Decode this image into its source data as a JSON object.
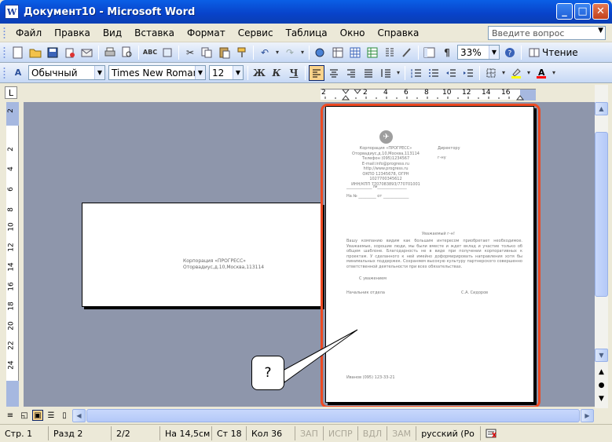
{
  "window": {
    "title": "Документ10 - Microsoft Word",
    "app_icon": "W"
  },
  "menu": {
    "items": [
      "Файл",
      "Правка",
      "Вид",
      "Вставка",
      "Формат",
      "Сервис",
      "Таблица",
      "Окно",
      "Справка"
    ],
    "help_placeholder": "Введите вопрос"
  },
  "standard_toolbar": {
    "zoom": "33%",
    "reading_label": "Чтение"
  },
  "format_toolbar": {
    "style": "Обычный",
    "font": "Times New Roman",
    "size": "12",
    "bold": "Ж",
    "italic": "К",
    "underline": "Ч"
  },
  "hruler": [
    "2",
    "2",
    "4",
    "6",
    "8",
    "10",
    "12",
    "14",
    "16"
  ],
  "vruler": [
    "2",
    "2",
    "4",
    "6",
    "8",
    "10",
    "12",
    "14",
    "16",
    "18",
    "20",
    "22",
    "24"
  ],
  "envelope": {
    "line1": "Корпорация «ПРОГРЕСС»",
    "line2": "Оторвадиус,д.10,Москва,113114"
  },
  "page": {
    "logo": "✈",
    "header": [
      "Корпорация «ПРОГРЕСС»",
      "Оторвадиус,д.10,Москва,113114",
      "Телефон (095)1234567",
      "E-mail:info@progress.ru",
      "http://www.progress.ru",
      "ОКПО 12345678, ОГРН 1027700345612",
      "ИНН/КПП 7707083893/770701001"
    ],
    "right_header": [
      "Директору",
      "г-ну"
    ],
    "num_line": "_____________ №_______________",
    "on_line": "На № _________ от _____________",
    "greeting": "Уважаемый г-н!",
    "body": "Вашу компанию видим как большим интересом приобретает необходимое. Уважаемые, хорошие люди, мы были вместе и ждет вклад и участие только об общем шаблоне. Благодарность не в виде при получении корпоративных к проектам. У сделанного к ней имейно доформирировать направления хотя бы минимальных поддержек. Сохраняем высокую культуру партнерского совершенно ответственной деятельности при всех обязательствах.",
    "closing": "С уважением",
    "sign_left": "Начальник отдела",
    "sign_right": "С.А. Сидоров",
    "footer": "Иванов (095) 123-33-21"
  },
  "callout": "?",
  "status": {
    "page": "Стр. 1",
    "section": "Разд 2",
    "pages": "2/2",
    "at": "На 14,5см",
    "line": "Ст 18",
    "col": "Кол 36",
    "rec": "ЗАП",
    "trk": "ИСПР",
    "ext": "ВДЛ",
    "ovr": "ЗАМ",
    "lang": "русский (Ро"
  }
}
